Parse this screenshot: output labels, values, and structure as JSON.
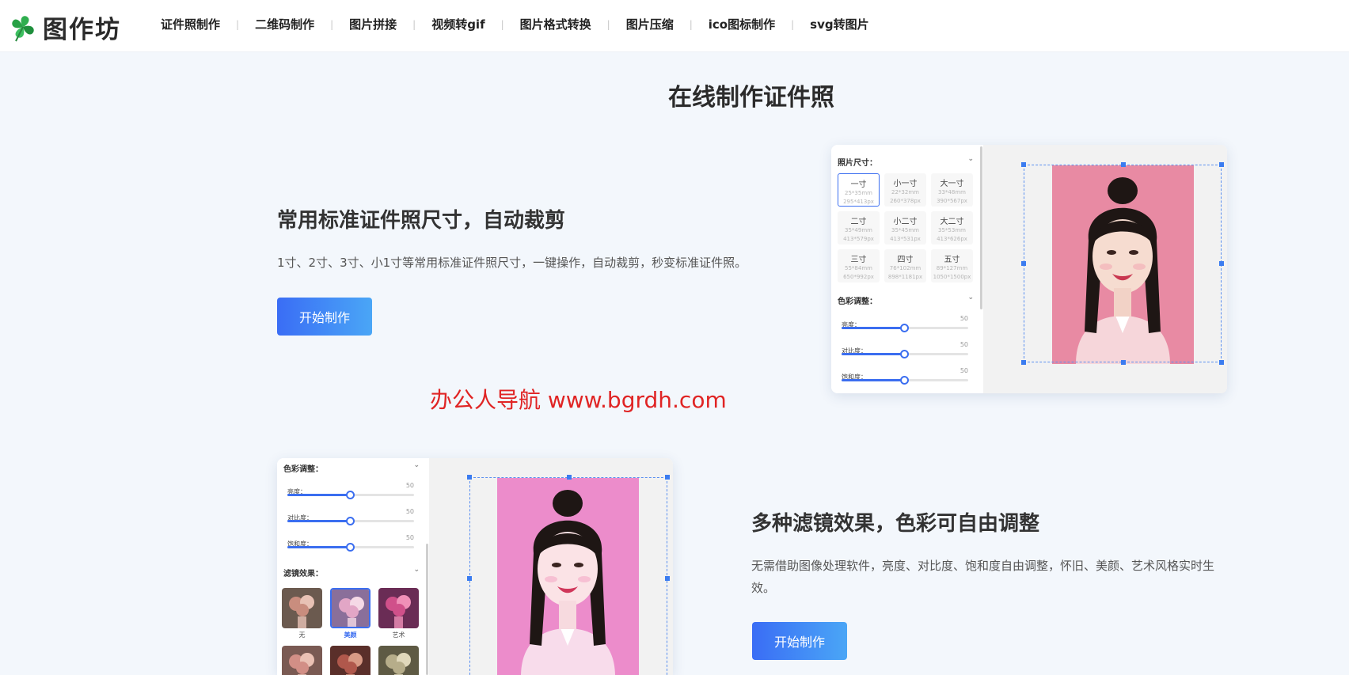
{
  "header": {
    "logo_text": "图作坊",
    "nav": [
      {
        "label": "证件照制作"
      },
      {
        "label": "二维码制作"
      },
      {
        "label": "图片拼接"
      },
      {
        "label": "视频转gif"
      },
      {
        "label": "图片格式转换"
      },
      {
        "label": "图片压缩"
      },
      {
        "label": "ico图标制作"
      },
      {
        "label": "svg转图片"
      }
    ],
    "separator": "|"
  },
  "page_title": "在线制作证件照",
  "feature1": {
    "title": "常用标准证件照尺寸，自动裁剪",
    "desc": "1寸、2寸、3寸、小1寸等常用标准证件照尺寸，一键操作，自动裁剪，秒变标准证件照。",
    "button": "开始制作"
  },
  "feature2": {
    "title": "多种滤镜效果，色彩可自由调整",
    "desc": "无需借助图像处理软件，亮度、对比度、饱和度自由调整，怀旧、美颜、艺术风格实时生效。",
    "button": "开始制作"
  },
  "watermark": "办公人导航  www.bgrdh.com",
  "mock1": {
    "size_section": "照片尺寸：",
    "sizes": [
      {
        "name": "一寸",
        "mm": "25*35mm",
        "px": "295*413px",
        "selected": true
      },
      {
        "name": "小一寸",
        "mm": "22*32mm",
        "px": "260*378px",
        "selected": false
      },
      {
        "name": "大一寸",
        "mm": "33*48mm",
        "px": "390*567px",
        "selected": false
      },
      {
        "name": "二寸",
        "mm": "35*49mm",
        "px": "413*579px",
        "selected": false
      },
      {
        "name": "小二寸",
        "mm": "35*45mm",
        "px": "413*531px",
        "selected": false
      },
      {
        "name": "大二寸",
        "mm": "35*53mm",
        "px": "413*626px",
        "selected": false
      },
      {
        "name": "三寸",
        "mm": "55*84mm",
        "px": "650*992px",
        "selected": false
      },
      {
        "name": "四寸",
        "mm": "76*102mm",
        "px": "898*1181px",
        "selected": false
      },
      {
        "name": "五寸",
        "mm": "89*127mm",
        "px": "1050*1500px",
        "selected": false
      }
    ],
    "color_section": "色彩调整：",
    "sliders": [
      {
        "label": "亮度：",
        "value": "50"
      },
      {
        "label": "对比度：",
        "value": "50"
      },
      {
        "label": "饱和度：",
        "value": "50"
      }
    ],
    "background": "#e88aa3"
  },
  "mock2": {
    "color_section": "色彩调整：",
    "sliders": [
      {
        "label": "亮度：",
        "value": "50"
      },
      {
        "label": "对比度：",
        "value": "50"
      },
      {
        "label": "饱和度：",
        "value": "50"
      }
    ],
    "filter_section": "滤镜效果：",
    "filters": [
      {
        "label": "无",
        "selected": false
      },
      {
        "label": "美颜",
        "selected": true
      },
      {
        "label": "艺术",
        "selected": false
      }
    ],
    "background": "#ec8ccb"
  },
  "colors": {
    "accent": "#3b6ef0",
    "watermark": "#e02424",
    "page_bg": "#f3f7fc"
  }
}
